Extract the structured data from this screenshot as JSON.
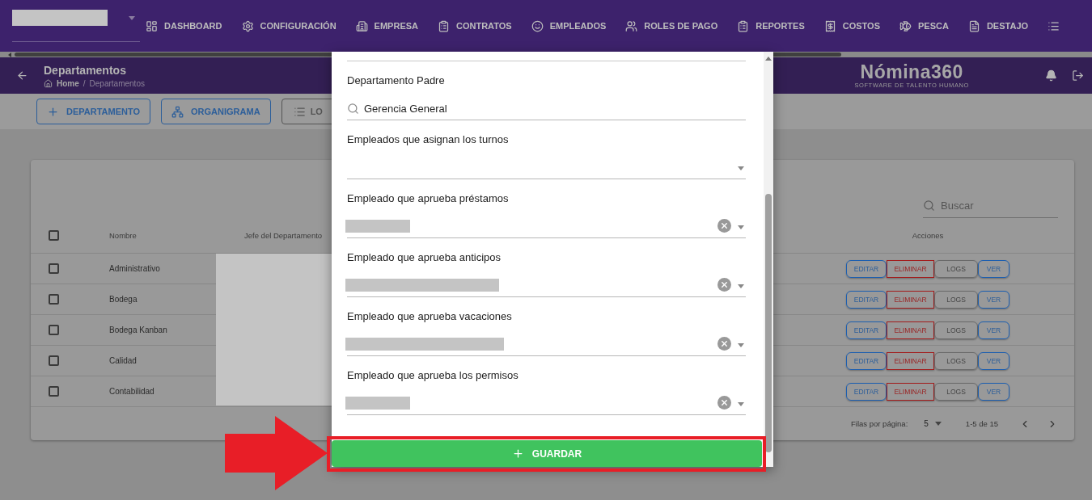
{
  "nav": [
    {
      "kind": "dashboard",
      "label": "DASHBOARD"
    },
    {
      "kind": "settings",
      "label": "CONFIGURACIÓN"
    },
    {
      "kind": "building",
      "label": "EMPRESA"
    },
    {
      "kind": "clipboard",
      "label": "CONTRATOS"
    },
    {
      "kind": "face",
      "label": "EMPLEADOS"
    },
    {
      "kind": "people",
      "label": "ROLES DE PAGO"
    },
    {
      "kind": "clipboard",
      "label": "REPORTES"
    },
    {
      "kind": "receipt",
      "label": "COSTOS"
    },
    {
      "kind": "fish",
      "label": "PESCA"
    },
    {
      "kind": "document",
      "label": "DESTAJO"
    }
  ],
  "header": {
    "title": "Departamentos",
    "breadcrumb": [
      "Home",
      "Departamentos"
    ],
    "breadcrumb_separator": "/",
    "logo": "Nómina360",
    "tagline": "SOFTWARE DE TALENTO HUMANO"
  },
  "toolbar": [
    {
      "kind": "add",
      "label": "DEPARTAMENTO"
    },
    {
      "kind": "org",
      "label": "ORGANIGRAMA"
    },
    {
      "kind": "list",
      "label": "LO"
    }
  ],
  "table": {
    "search_placeholder": "Buscar",
    "all_checked": false,
    "columns": [
      "Nombre",
      "Jefe del Departamento",
      "Acciones"
    ],
    "rows": [
      {
        "name": "Administrativo",
        "checked": false,
        "actions": [
          "EDITAR",
          "ELIMINAR",
          "LOGS",
          "VER"
        ]
      },
      {
        "name": "Bodega",
        "checked": false,
        "actions": [
          "EDITAR",
          "ELIMINAR",
          "LOGS",
          "VER"
        ]
      },
      {
        "name": "Bodega Kanban",
        "checked": false,
        "actions": [
          "EDITAR",
          "ELIMINAR",
          "LOGS",
          "VER"
        ]
      },
      {
        "name": "Calidad",
        "checked": false,
        "actions": [
          "EDITAR",
          "ELIMINAR",
          "LOGS",
          "VER"
        ]
      },
      {
        "name": "Contabilidad",
        "checked": false,
        "actions": [
          "EDITAR",
          "ELIMINAR",
          "LOGS",
          "VER"
        ]
      }
    ],
    "pagination": {
      "rows_per_page_label": "Filas por página:",
      "rows_per_page": "5",
      "range": "1-5 de 15"
    }
  },
  "modal": {
    "fields": [
      {
        "kind": "search",
        "label": "Departamento Padre",
        "value": "Gerencia General"
      },
      {
        "kind": "select",
        "label": "Empleados que asignan los turnos",
        "filled": false
      },
      {
        "kind": "select",
        "label": "Empleado que aprueba préstamos",
        "filled": true
      },
      {
        "kind": "select",
        "label": "Empleado que aprueba anticipos",
        "filled": true
      },
      {
        "kind": "select",
        "label": "Empleado que aprueba vacaciones",
        "filled": true
      },
      {
        "kind": "select",
        "label": "Empleado que aprueba los permisos",
        "filled": true
      }
    ],
    "save_button": "GUARDAR"
  }
}
